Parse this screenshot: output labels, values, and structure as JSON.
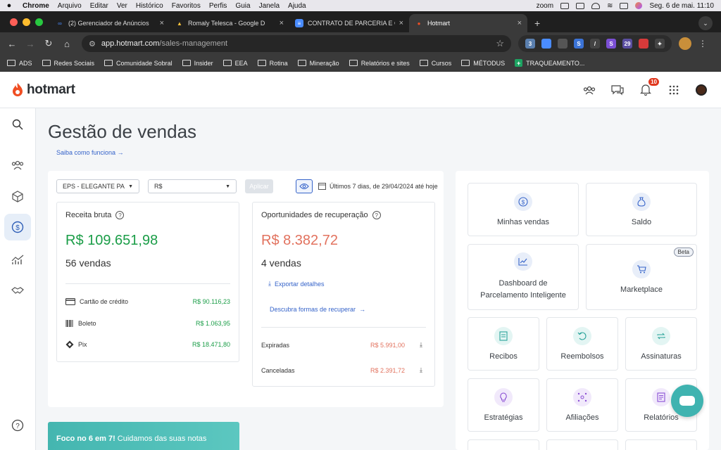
{
  "menubar": {
    "app": "Chrome",
    "items": [
      "Arquivo",
      "Editar",
      "Ver",
      "Histórico",
      "Favoritos",
      "Perfis",
      "Guia",
      "Janela",
      "Ajuda"
    ],
    "zoom": "zoom",
    "datetime": "Seg. 6 de mai.  11:10"
  },
  "tabs": [
    {
      "title": "(2) Gerenciador de Anúncios",
      "icon": "meta-icon"
    },
    {
      "title": "Romaly Telesca - Google D",
      "icon": "drive-icon"
    },
    {
      "title": "CONTRATO DE PARCERIA E C",
      "icon": "docs-icon"
    },
    {
      "title": "Hotmart",
      "icon": "hotmart-icon",
      "active": true
    }
  ],
  "address": {
    "host": "app.hotmart.com",
    "path": "/sales-management"
  },
  "extensions": {
    "badge_a": "3",
    "badge_b": "29"
  },
  "bookmarks": [
    "ADS",
    "Redes Sociais",
    "Comunidade Sobral",
    "Insider",
    "EEA",
    "Rotina",
    "Mineração",
    "Relatórios e sites",
    "Cursos",
    "MÉTODUS",
    "TRAQUEAMENTO..."
  ],
  "header": {
    "logo": "hotmart",
    "notif_count": "10",
    "brand_color": "#f04e23"
  },
  "page": {
    "title": "Gestão de vendas",
    "saiba": "Saiba como funciona"
  },
  "filters": {
    "product": "EPS - ELEGANTE PAR",
    "currency": "R$",
    "apply": "Aplicar",
    "period": "Últimos 7 dias, de 29/04/2024 até hoje"
  },
  "receita": {
    "title": "Receita bruta",
    "total": "R$ 109.651,98",
    "count": "56 vendas",
    "rows": [
      {
        "label": "Cartão de crédito",
        "value": "R$ 90.116,23",
        "icon": "credit-card-icon"
      },
      {
        "label": "Boleto",
        "value": "R$ 1.063,95",
        "icon": "barcode-icon"
      },
      {
        "label": "Pix",
        "value": "R$ 18.471,80",
        "icon": "pix-icon"
      }
    ]
  },
  "recuperacao": {
    "title": "Oportunidades de recuperação",
    "total": "R$ 8.382,72",
    "count": "4 vendas",
    "export": "Exportar detalhes",
    "discover": "Descubra formas de recuperar",
    "rows": [
      {
        "label": "Expiradas",
        "value": "R$ 5.991,00"
      },
      {
        "label": "Canceladas",
        "value": "R$ 2.391,72"
      }
    ]
  },
  "tiles": {
    "minhas_vendas": "Minhas vendas",
    "saldo": "Saldo",
    "dashboard": "Dashboard de Parcelamento Inteligente",
    "marketplace": "Marketplace",
    "beta": "Beta",
    "recibos": "Recibos",
    "reembolsos": "Reembolsos",
    "assinaturas": "Assinaturas",
    "estrategias": "Estratégias",
    "afiliacoes": "Afiliações",
    "relatorios": "Relatórios"
  },
  "promo": {
    "bold": "Foco no 6 em 7!",
    "text": " Cuidamos das suas notas"
  }
}
